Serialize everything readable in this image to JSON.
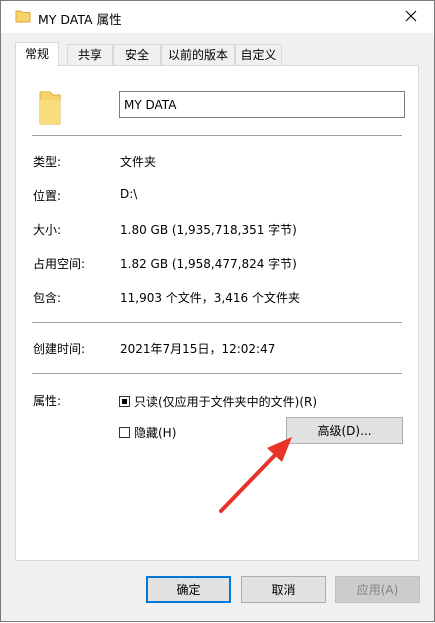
{
  "window": {
    "title": "MY DATA 属性",
    "close_icon": "close-icon"
  },
  "tabs": [
    {
      "label": "常规",
      "active": true
    },
    {
      "label": "共享",
      "active": false
    },
    {
      "label": "安全",
      "active": false
    },
    {
      "label": "以前的版本",
      "active": false
    },
    {
      "label": "自定义",
      "active": false
    }
  ],
  "general": {
    "folder_name": "MY DATA",
    "type_label": "类型:",
    "type_value": "文件夹",
    "location_label": "位置:",
    "location_value": "D:\\",
    "size_label": "大小:",
    "size_value": "1.80 GB (1,935,718,351 字节)",
    "size_on_disk_label": "占用空间:",
    "size_on_disk_value": "1.82 GB (1,958,477,824 字节)",
    "contains_label": "包含:",
    "contains_value": "11,903 个文件，3,416 个文件夹",
    "created_label": "创建时间:",
    "created_value": "2021年7月15日，12:02:47",
    "attributes_label": "属性:",
    "readonly_label": "只读(仅应用于文件夹中的文件)(R)",
    "hidden_label": "隐藏(H)",
    "advanced_button": "高级(D)..."
  },
  "footer": {
    "ok": "确定",
    "cancel": "取消",
    "apply": "应用(A)"
  },
  "colors": {
    "accent": "#0078d7",
    "annotation_arrow": "#e8332a",
    "folder": "#f7d46b"
  }
}
